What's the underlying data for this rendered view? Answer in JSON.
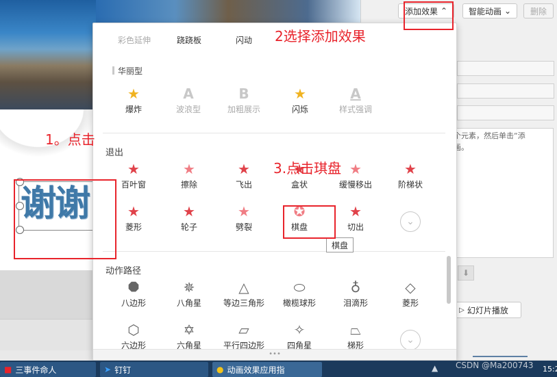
{
  "right_panel": {
    "add_effect_label": "添加效果",
    "smart_anim_label": "智能动画",
    "delete_label": "删除",
    "hint_text": "某个元素，然后单击“添\n动画。",
    "slideshow_label": "幻灯片播放"
  },
  "popup": {
    "top_row": [
      "彩色延伸",
      "跷跷板",
      "闪动"
    ],
    "sections": {
      "huali": {
        "title": "华丽型",
        "items": [
          {
            "label": "爆炸",
            "icon": "explode-star-icon"
          },
          {
            "label": "波浪型",
            "icon": "wave-letter-icon"
          },
          {
            "label": "加粗展示",
            "icon": "bold-letter-icon"
          },
          {
            "label": "闪烁",
            "icon": "flash-star-icon"
          },
          {
            "label": "样式强调",
            "icon": "style-letter-icon"
          }
        ]
      },
      "exit": {
        "title": "退出",
        "items": [
          {
            "label": "百叶窗",
            "icon": "star-icon"
          },
          {
            "label": "擦除",
            "icon": "star-icon"
          },
          {
            "label": "飞出",
            "icon": "star-icon"
          },
          {
            "label": "盒状",
            "icon": "star-icon"
          },
          {
            "label": "缓慢移出",
            "icon": "star-icon"
          },
          {
            "label": "阶梯状",
            "icon": "star-icon"
          },
          {
            "label": "菱形",
            "icon": "star-icon"
          },
          {
            "label": "轮子",
            "icon": "star-icon"
          },
          {
            "label": "劈裂",
            "icon": "star-icon"
          },
          {
            "label": "棋盘",
            "icon": "star-icon"
          },
          {
            "label": "切出",
            "icon": "star-icon"
          }
        ]
      },
      "path": {
        "title": "动作路径",
        "items": [
          {
            "label": "八边形",
            "icon": "octagon-path-icon"
          },
          {
            "label": "八角星",
            "icon": "eight-star-path-icon"
          },
          {
            "label": "等边三角形",
            "icon": "triangle-path-icon"
          },
          {
            "label": "橄榄球形",
            "icon": "football-path-icon"
          },
          {
            "label": "泪滴形",
            "icon": "teardrop-path-icon"
          },
          {
            "label": "菱形",
            "icon": "diamond-path-icon"
          },
          {
            "label": "六边形",
            "icon": "hexagon-path-icon"
          },
          {
            "label": "六角星",
            "icon": "six-star-path-icon"
          },
          {
            "label": "平行四边形",
            "icon": "parallelogram-path-icon"
          },
          {
            "label": "四角星",
            "icon": "four-star-path-icon"
          },
          {
            "label": "梯形",
            "icon": "trapezoid-path-icon"
          }
        ]
      }
    },
    "tooltip": "棋盘"
  },
  "slide": {
    "title_text": "谢谢"
  },
  "annotations": {
    "step1": "1。点击",
    "step2": "2选择添加效果",
    "step3": "3.点击琪盘"
  },
  "taskbar": {
    "tasks": [
      "三事件命人",
      "钉钉",
      "动画效果应用指"
    ],
    "watermark": "CSDN @Ma200743",
    "clock": "15:2"
  },
  "colors": {
    "annotation_red": "#e8232b",
    "star_red": "#e0424a",
    "taskbar": "#1b3a5c"
  }
}
